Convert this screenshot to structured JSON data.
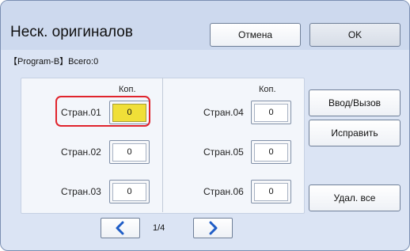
{
  "header": {
    "title": "Неск. оригиналов",
    "cancel_label": "Отмена",
    "ok_label": "OK"
  },
  "program_line": "【Program-B】Всего:0",
  "copies_header": "Коп.",
  "pages": [
    {
      "label": "Стран.01",
      "value": "0",
      "selected": true
    },
    {
      "label": "Стран.02",
      "value": "0"
    },
    {
      "label": "Стран.03",
      "value": "0"
    },
    {
      "label": "Стран.04",
      "value": "0"
    },
    {
      "label": "Стран.05",
      "value": "0"
    },
    {
      "label": "Стран.06",
      "value": "0"
    }
  ],
  "pagination": {
    "indicator": "1/4"
  },
  "side_buttons": {
    "entry": "Ввод/Вызов",
    "edit": "Исправить",
    "clear_all": "Удал. все"
  },
  "colors": {
    "selected_fill": "#f0df38",
    "highlight_border": "#e0242d",
    "nav_arrow": "#1f5dc6"
  }
}
